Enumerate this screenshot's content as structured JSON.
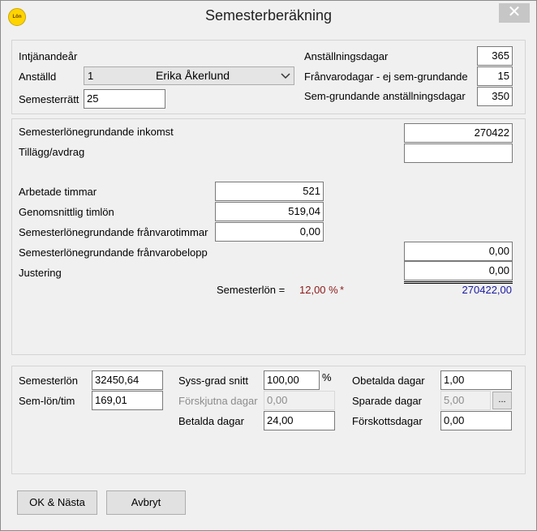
{
  "window": {
    "title": "Semesterberäkning",
    "icon_text": "Lön",
    "close_glyph": "✕"
  },
  "top": {
    "intjanandear_label": "Intjänandeår",
    "anstalld_label": "Anställd",
    "anstalld_number": "1",
    "anstalld_name": "Erika Åkerlund",
    "semesterratt_label": "Semesterrätt",
    "semesterratt_value": "25",
    "anstallningsdagar_label": "Anställningsdagar",
    "anstallningsdagar_value": "365",
    "franvarodagar_label": "Frånvarodagar - ej sem-grundande",
    "franvarodagar_value": "15",
    "semgrundande_label": "Sem-grundande anställningsdagar",
    "semgrundande_value": "350"
  },
  "middle": {
    "inkomst_label": "Semesterlönegrundande inkomst",
    "inkomst_value": "270422",
    "tillagg_label": "Tillägg/avdrag",
    "tillagg_value": "",
    "arbetade_label": "Arbetade timmar",
    "arbetade_value": "521",
    "timlon_label": "Genomsnittlig timlön",
    "timlon_value": "519,04",
    "franvarotimmar_label": "Semesterlönegrundande frånvarotimmar",
    "franvarotimmar_value": "0,00",
    "franvarobelopp_label": "Semesterlönegrundande frånvarobelopp",
    "franvarobelopp_value": "0,00",
    "justering_label": "Justering",
    "justering_value": "0,00",
    "semesterlon_label": "Semesterlön  =",
    "semesterlon_percent": "12,00 %",
    "semesterlon_star": "*",
    "semesterlon_total": "270422,00"
  },
  "bottom": {
    "semesterlon_label": "Semesterlön",
    "semesterlon_value": "32450,64",
    "semlontim_label": "Sem-lön/tim",
    "semlontim_value": "169,01",
    "syssgrad_label": "Syss-grad snitt",
    "syssgrad_value": "100,00",
    "syssgrad_unit": "%",
    "forskjutna_label": "Förskjutna dagar",
    "forskjutna_value": "0,00",
    "betalda_label": "Betalda dagar",
    "betalda_value": "24,00",
    "obetalda_label": "Obetalda dagar",
    "obetalda_value": "1,00",
    "sparade_label": "Sparade dagar",
    "sparade_value": "5,00",
    "sparade_button": "...",
    "forskott_label": "Förskottsdagar",
    "forskott_value": "0,00"
  },
  "buttons": {
    "ok_label": "OK & Nästa",
    "cancel_label": "Avbryt"
  },
  "colors": {
    "percent_color": "#8b1a1a",
    "total_color": "#1a1aa0"
  }
}
